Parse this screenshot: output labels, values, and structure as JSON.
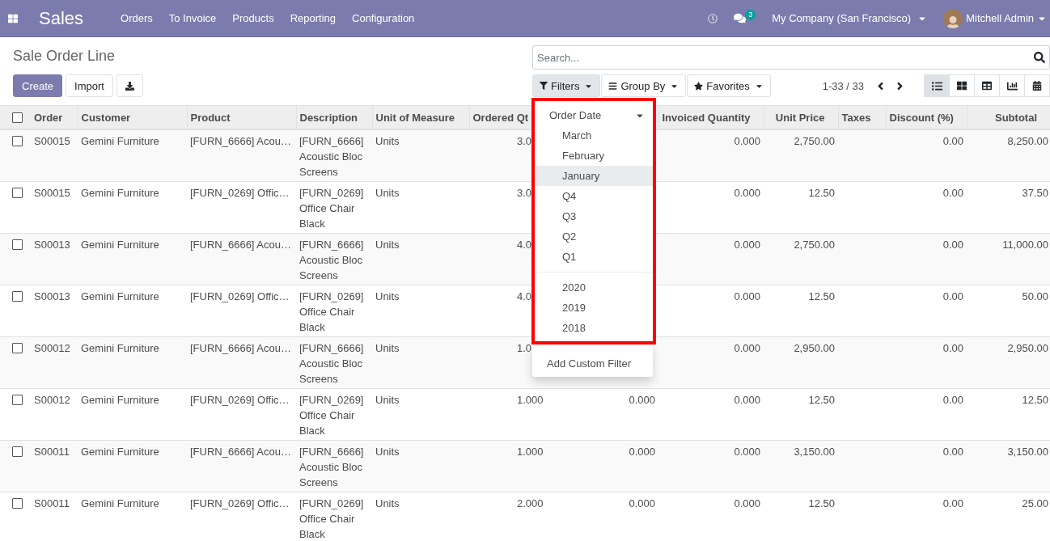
{
  "navbar": {
    "app_title": "Sales",
    "menu": [
      "Orders",
      "To Invoice",
      "Products",
      "Reporting",
      "Configuration"
    ],
    "message_count": "3",
    "company": "My Company (San Francisco)",
    "user": "Mitchell Admin"
  },
  "control_panel": {
    "title": "Sale Order Line",
    "buttons": [
      {
        "kind": "primary",
        "label": "Create"
      },
      {
        "kind": "secondary",
        "label": "Import"
      },
      {
        "kind": "download"
      }
    ],
    "search": {
      "placeholder": "Search..."
    },
    "search_options": [
      {
        "kind": "filter",
        "label": "Filters",
        "selected": true
      },
      {
        "kind": "group",
        "label": "Group By",
        "selected": false
      },
      {
        "kind": "favorite",
        "label": "Favorites",
        "selected": false
      }
    ],
    "pager": "1-33 / 33",
    "views": [
      {
        "kind": "list",
        "selected": true
      },
      {
        "kind": "kanban",
        "selected": false
      },
      {
        "kind": "pivot",
        "selected": false
      },
      {
        "kind": "graph",
        "selected": false
      },
      {
        "kind": "calendar",
        "selected": false
      }
    ]
  },
  "filters_menu": {
    "annotation_frame": true,
    "groups": [
      {
        "label": "Order Date",
        "expanded": true,
        "sections": [
          {
            "options": [
              {
                "label": "March",
                "highlighted": false
              },
              {
                "label": "February",
                "highlighted": false
              },
              {
                "label": "January",
                "highlighted": true
              },
              {
                "label": "Q4",
                "highlighted": false
              },
              {
                "label": "Q3",
                "highlighted": false
              },
              {
                "label": "Q2",
                "highlighted": false
              },
              {
                "label": "Q1",
                "highlighted": false
              }
            ]
          },
          {
            "options": [
              {
                "label": "2020",
                "highlighted": false
              },
              {
                "label": "2019",
                "highlighted": false
              },
              {
                "label": "2018",
                "highlighted": false
              }
            ]
          }
        ]
      }
    ],
    "custom_filter": "Add Custom Filter"
  },
  "table": {
    "all_checked": false,
    "columns": [
      "Order",
      "Customer",
      "Product",
      "Description",
      "Unit of Measure",
      "Ordered Qt",
      null,
      "Invoiced Quantity",
      "Unit Price",
      "Taxes",
      "Discount (%)",
      "Subtotal"
    ],
    "rows": [
      {
        "checked": false,
        "cells": [
          "S00015",
          "Gemini Furniture",
          "[FURN_6666] Acou…",
          "[FURN_6666] Acoustic Bloc Screens",
          "Units",
          "3.0",
          null,
          "0.000",
          "2,750.00",
          null,
          "0.00",
          "8,250.00"
        ]
      },
      {
        "checked": false,
        "cells": [
          "S00015",
          "Gemini Furniture",
          "[FURN_0269] Offic…",
          "[FURN_0269] Office Chair Black",
          "Units",
          "3.0",
          null,
          "0.000",
          "12.50",
          null,
          "0.00",
          "37.50"
        ]
      },
      {
        "checked": false,
        "cells": [
          "S00013",
          "Gemini Furniture",
          "[FURN_6666] Acou…",
          "[FURN_6666] Acoustic Bloc Screens",
          "Units",
          "4.0",
          null,
          "0.000",
          "2,750.00",
          null,
          "0.00",
          "11,000.00"
        ]
      },
      {
        "checked": false,
        "cells": [
          "S00013",
          "Gemini Furniture",
          "[FURN_0269] Offic…",
          "[FURN_0269] Office Chair Black",
          "Units",
          "4.0",
          null,
          "0.000",
          "12.50",
          null,
          "0.00",
          "50.00"
        ]
      },
      {
        "checked": false,
        "cells": [
          "S00012",
          "Gemini Furniture",
          "[FURN_6666] Acou…",
          "[FURN_6666] Acoustic Bloc Screens",
          "Units",
          "1.0",
          null,
          "0.000",
          "2,950.00",
          null,
          "0.00",
          "2,950.00"
        ]
      },
      {
        "checked": false,
        "cells": [
          "S00012",
          "Gemini Furniture",
          "[FURN_0269] Offic…",
          "[FURN_0269] Office Chair Black",
          "Units",
          "1.000",
          "0.000",
          "0.000",
          "12.50",
          null,
          "0.00",
          "12.50"
        ]
      },
      {
        "checked": false,
        "cells": [
          "S00011",
          "Gemini Furniture",
          "[FURN_6666] Acou…",
          "[FURN_6666] Acoustic Bloc Screens",
          "Units",
          "1.000",
          "0.000",
          "0.000",
          "3,150.00",
          null,
          "0.00",
          "3,150.00"
        ]
      },
      {
        "checked": false,
        "cells": [
          "S00011",
          "Gemini Furniture",
          "[FURN_0269] Offic…",
          "[FURN_0269] Office Chair Black",
          "Units",
          "2.000",
          "0.000",
          "0.000",
          "12.50",
          null,
          "0.00",
          "25.00"
        ]
      }
    ]
  }
}
